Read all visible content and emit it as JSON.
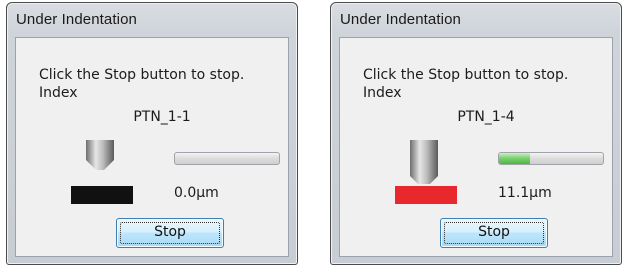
{
  "colors": {
    "sample_idle": "#111111",
    "sample_active": "#e8282d",
    "progress_fill": "#5fc255",
    "button_border": "#3c7fb1"
  },
  "dialogs": [
    {
      "title": "Under Indentation",
      "message": "Click the Stop button to stop.",
      "index_label": "Index",
      "pattern_id": "PTN_1-1",
      "depth": "0.0µm",
      "progress": 0.0,
      "indenter_state": "raised",
      "sample_color": "#111111",
      "stop_label": "Stop"
    },
    {
      "title": "Under Indentation",
      "message": "Click the Stop button to stop.",
      "index_label": "Index",
      "pattern_id": "PTN_1-4",
      "depth": "11.1µm",
      "progress": 0.3,
      "indenter_state": "lowered",
      "sample_color": "#e8282d",
      "stop_label": "Stop"
    }
  ]
}
